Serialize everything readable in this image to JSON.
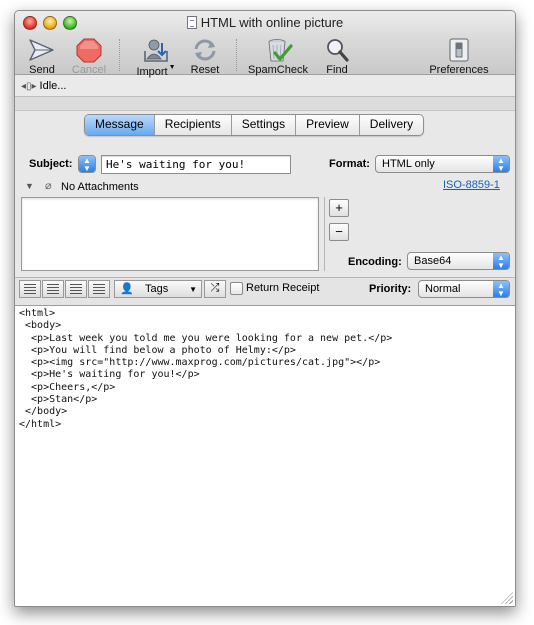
{
  "window": {
    "title": "HTML with online picture"
  },
  "toolbar": {
    "send": "Send",
    "cancel": "Cancel",
    "import": "Import",
    "reset": "Reset",
    "spamcheck": "SpamCheck",
    "find": "Find",
    "preferences": "Preferences"
  },
  "status": {
    "text": "Idle..."
  },
  "tabs": [
    "Message",
    "Recipients",
    "Settings",
    "Preview",
    "Delivery"
  ],
  "tabs_active": "Message",
  "subject": {
    "label": "Subject:",
    "value": "He's waiting for you!"
  },
  "format": {
    "label": "Format:",
    "value": "HTML only"
  },
  "attachments": {
    "label": "No Attachments",
    "charset_link": "ISO-8859-1"
  },
  "encoding": {
    "label": "Encoding:",
    "value": "Base64"
  },
  "format_bar": {
    "tags_label": "Tags",
    "return_receipt": "Return Receipt",
    "priority_label": "Priority:",
    "priority_value": "Normal"
  },
  "body_lines": [
    "<html>",
    " <body>",
    "  <p>Last week you told me you were looking for a new pet.</p>",
    "  <p>You will find below a photo of Helmy:</p>",
    "  <p><img src=\"http://www.maxprog.com/pictures/cat.jpg\"></p>",
    "  <p>He's waiting for you!</p>",
    "  <p>Cheers,</p>",
    "  <p>Stan</p>",
    " </body>",
    "</html>"
  ],
  "colors": {
    "accent": "#3d8ae6",
    "link": "#1a5fb4",
    "stop": "#e2403a"
  }
}
